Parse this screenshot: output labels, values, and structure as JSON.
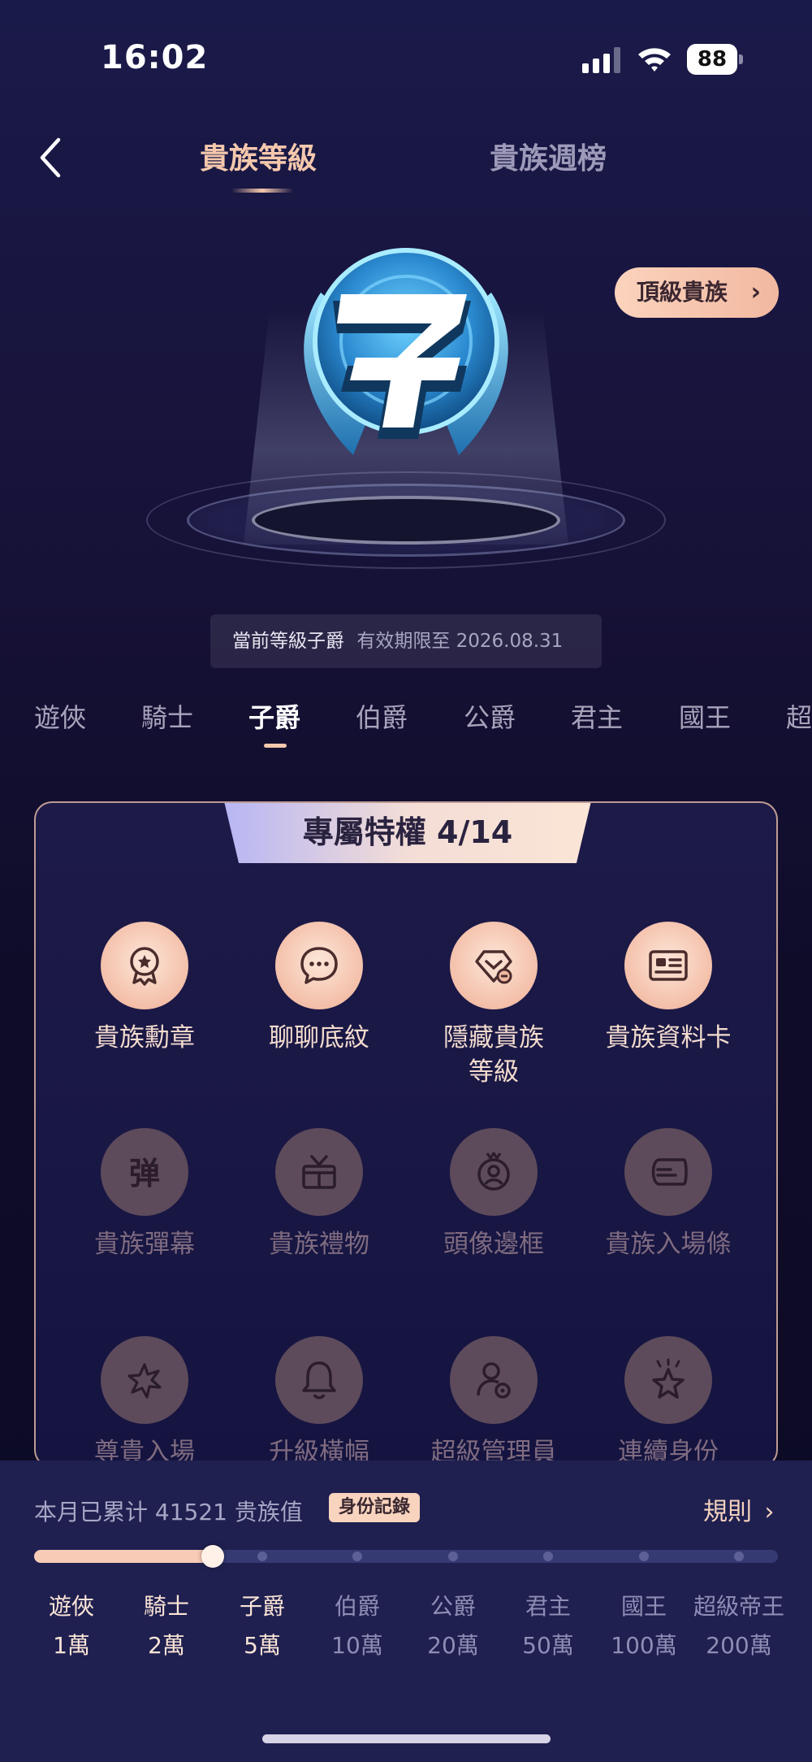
{
  "status_bar": {
    "time": "16:02",
    "battery": "88"
  },
  "nav": {
    "tabs": [
      {
        "label": "貴族等級",
        "active": true
      },
      {
        "label": "貴族週榜",
        "active": false
      }
    ]
  },
  "hero": {
    "badge_icon": "viscount-badge-icon",
    "top_noble_button": "頂級貴族",
    "current_level_text": "當前等級子爵",
    "expiry_text": "有效期限至 2026.08.31"
  },
  "levels": [
    {
      "label": "遊俠"
    },
    {
      "label": "騎士"
    },
    {
      "label": "子爵",
      "active": true
    },
    {
      "label": "伯爵"
    },
    {
      "label": "公爵"
    },
    {
      "label": "君主"
    },
    {
      "label": "國王"
    },
    {
      "label": "超"
    }
  ],
  "privileges": {
    "title": "專屬特權 4/14",
    "items": [
      {
        "label": "貴族勳章",
        "icon": "medal-icon",
        "unlocked": true
      },
      {
        "label": "聊聊底紋",
        "icon": "chat-bubble-icon",
        "unlocked": true
      },
      {
        "label": "隱藏貴族\n等級",
        "icon": "hidden-badge-icon",
        "unlocked": true
      },
      {
        "label": "貴族資料卡",
        "icon": "profile-card-icon",
        "unlocked": true
      },
      {
        "label": "貴族彈幕",
        "icon": "barrage-icon",
        "unlocked": false
      },
      {
        "label": "貴族禮物",
        "icon": "gift-box-icon",
        "unlocked": false
      },
      {
        "label": "頭像邊框",
        "icon": "avatar-frame-icon",
        "unlocked": false
      },
      {
        "label": "貴族入場條",
        "icon": "entrance-bar-icon",
        "unlocked": false
      },
      {
        "label": "尊貴入場",
        "icon": "sparkle-entrance-icon",
        "unlocked": false
      },
      {
        "label": "升級橫幅",
        "icon": "bell-icon",
        "unlocked": false
      },
      {
        "label": "超級管理員",
        "icon": "admin-user-icon",
        "unlocked": false
      },
      {
        "label": "連續身份",
        "icon": "star-crown-icon",
        "unlocked": false
      }
    ]
  },
  "progress": {
    "accumulated_text": "本月已累计 41521 贵族值",
    "record_button": "身份記錄",
    "rules_link": "規則",
    "fraction": 0.24,
    "tiers": [
      {
        "name": "遊俠",
        "value": "1萬",
        "reached": true
      },
      {
        "name": "騎士",
        "value": "2萬",
        "reached": true
      },
      {
        "name": "子爵",
        "value": "5萬",
        "reached": true
      },
      {
        "name": "伯爵",
        "value": "10萬",
        "reached": false
      },
      {
        "name": "公爵",
        "value": "20萬",
        "reached": false
      },
      {
        "name": "君主",
        "value": "50萬",
        "reached": false
      },
      {
        "name": "國王",
        "value": "100萬",
        "reached": false
      },
      {
        "name": "超級帝王",
        "value": "200萬",
        "reached": false
      }
    ]
  },
  "colors": {
    "accent": "#f5c8ad",
    "background": "#171238",
    "panel": "#1f2050"
  }
}
